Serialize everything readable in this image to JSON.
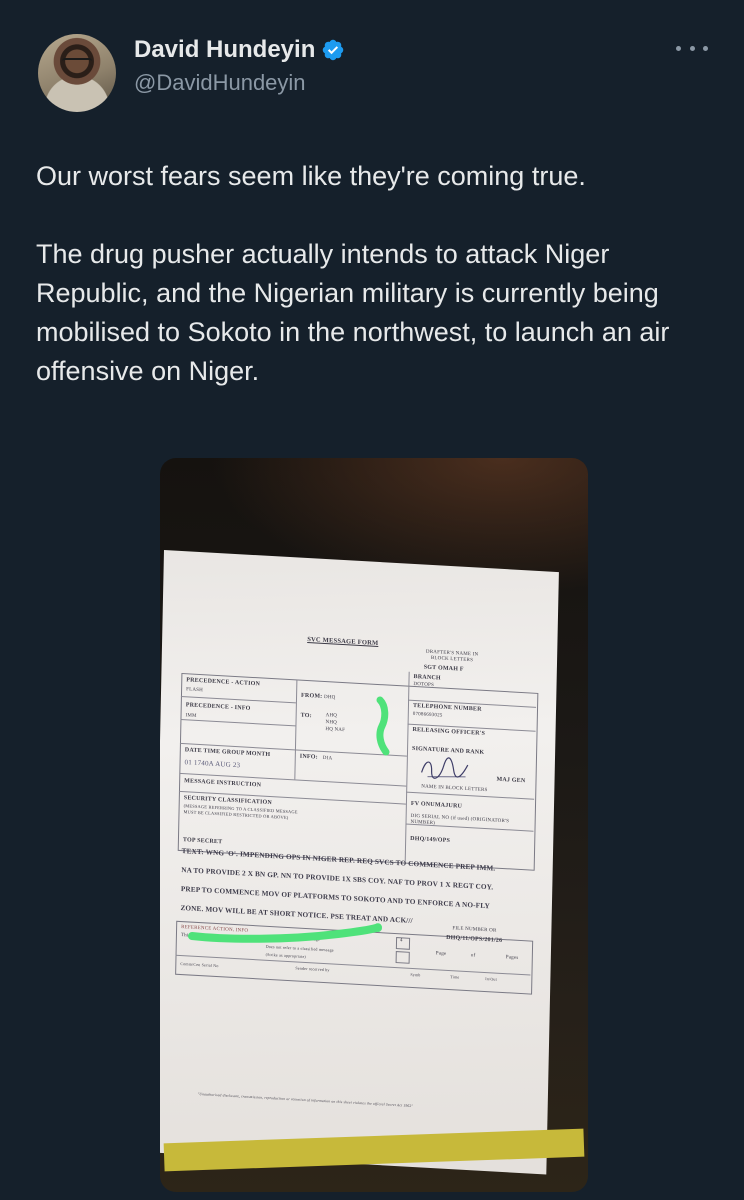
{
  "tweet": {
    "display_name": "David Hundeyin",
    "handle": "@DavidHundeyin",
    "verified": true,
    "more_icon": "more-horizontal-icon",
    "paragraphs": [
      "Our worst fears seem like they're coming true.",
      "The drug pusher actually intends to attack Niger Republic, and the Nigerian military is currently being mobilised to Sokoto in the northwest, to launch an air offensive on Niger."
    ]
  },
  "document": {
    "form_title": "SVC MESSAGE FORM",
    "drafter_label": "DRAFTER'S NAME IN BLOCK LETTERS",
    "drafter_name": "SGT OMAH F",
    "branch_label": "BRANCH",
    "branch_value": "DOTOPS",
    "telephone_label": "TELEPHONE NUMBER",
    "telephone_value": "07086693025",
    "releasing_label": "RELEASING OFFICER'S",
    "signature_label": "SIGNATURE AND RANK",
    "rank": "MAJ GEN",
    "name_block_label": "NAME IN BLOCK LETTERS",
    "officer_name": "FV ONUMAJURU",
    "serial_label": "DIG SERIAL NO (if used) (ORIGINATOR'S NUMBER)",
    "serial_value": "DHQ/149/OPS",
    "precedence_action_label": "PRECEDENCE - ACTION",
    "precedence_action_value": "FLASH",
    "precedence_info_label": "PRECEDENCE - INFO",
    "precedence_info_value": "IMM",
    "from_label": "FROM:",
    "from_value": "DHQ",
    "to_label": "TO:",
    "to_values": [
      "AHQ",
      "NHQ",
      "HQ NAF"
    ],
    "info_label": "INFO:",
    "info_value": "DIA",
    "dtg_label": "DATE TIME GROUP MONTH",
    "dtg_value": "01 1740A AUG 23",
    "message_instruction_label": "MESSAGE INSTRUCTION",
    "security_label": "SECURITY CLASSIFICATION",
    "security_note": "(MESSAGE REFERRING TO A CLASSIFIED MESSAGE MUST BE CLASSIFIED RESTRICTED OR ABOVE)",
    "security_value": "TOP SECRET",
    "text_lines": [
      "TEXT: WNG 'O'. IMPENDING OPS IN NIGER REP. REQ SVCS TO COMMENCE PREP IMM.",
      "NA TO PROVIDE 2 X BN GP. NN TO PROVIDE 1X SBS COY. NAF TO PROV 1 X REGT COY.",
      "PREP TO COMMENCE MOV OF PLATFORMS TO SOKOTO AND TO ENFORCE A NO-FLY",
      "ZONE. MOV WILL BE AT SHORT NOTICE. PSE TREAT AND ACK///"
    ],
    "file_number_label": "FILE NUMBER OR",
    "file_number_value": "DHQ/11/OPS/201/26",
    "reference_label": "REFERENCE ACTION, INFO",
    "this_message_label": "This message",
    "refers_classified": "Refers to a classified message",
    "not_refers_classified": "Does not refer to a classified message",
    "strike_note": "(Strike as appropriate)",
    "page_label": "Page",
    "of_label": "of",
    "pages_label": "Pages",
    "comm_serial_label": "Comm/Cen Serial No",
    "sender_label": "Sender received by",
    "symbol_label": "Symb",
    "time_label": "Time",
    "in_out_label": "In/Out",
    "box_value": "4",
    "footer": "\"Unauthorised disclosure, transmission, reproduction or retention of information on this sheet violates the official Secret Act 1962\""
  },
  "colors": {
    "background": "#15202b",
    "verified_badge": "#1d9bf0",
    "highlight": "#4fe27a"
  }
}
